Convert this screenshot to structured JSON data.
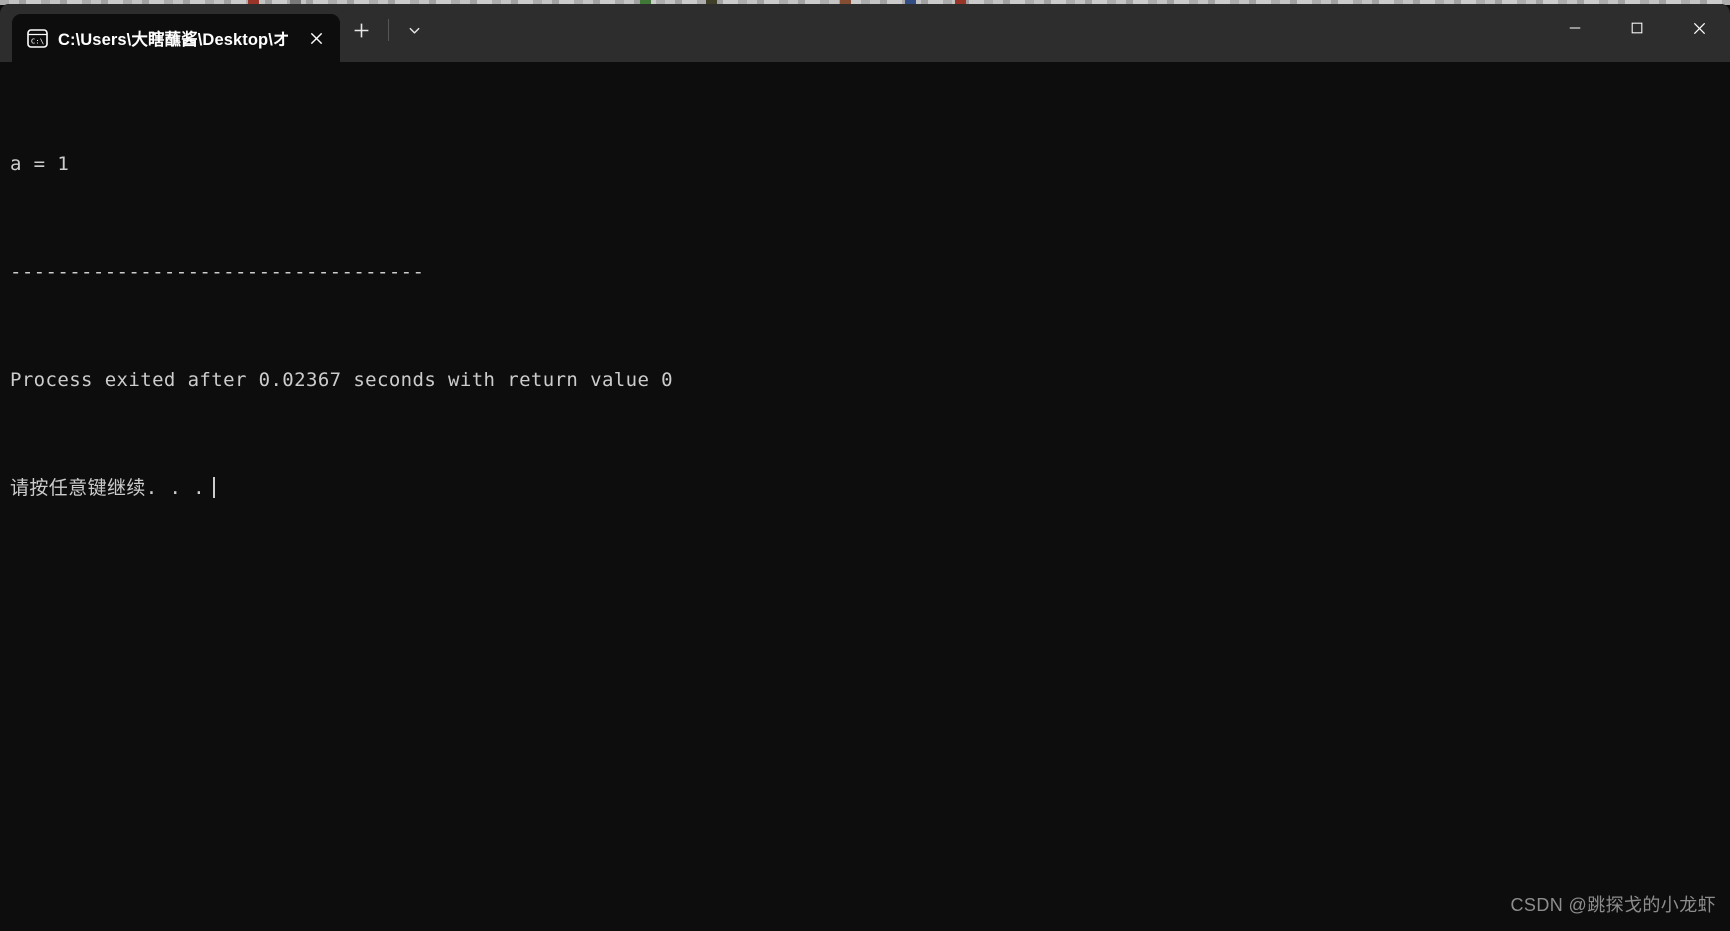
{
  "window": {
    "title_bar": {
      "tab": {
        "icon": "cmd-prompt-icon",
        "icon_text": "C:\\",
        "title": "C:\\Users\\大瞎蘸酱\\Desktop\\オ",
        "close_label": "✕"
      },
      "new_tab_label": "+",
      "dropdown_label": "⌄"
    },
    "controls": {
      "minimize_label": "—",
      "maximize_label": "▢",
      "close_label": "✕"
    }
  },
  "terminal": {
    "lines": [
      "a = 1",
      "-----------------------------------",
      "Process exited after 0.02367 seconds with return value 0",
      "请按任意键继续. . ."
    ],
    "line_a": "a = 1",
    "line_separator": "-----------------------------------",
    "line_exit": "Process exited after 0.02367 seconds with return value 0",
    "line_prompt": "请按任意键继续. . ."
  },
  "watermark": {
    "text": "CSDN @跳探戈的小龙虾"
  },
  "colors": {
    "titlebar_bg": "#2d2d2d",
    "terminal_bg": "#0d0d0d",
    "terminal_fg": "#cccccc",
    "tab_active_bg": "#0d0d0d",
    "watermark_fg": "#8d8d8d"
  }
}
